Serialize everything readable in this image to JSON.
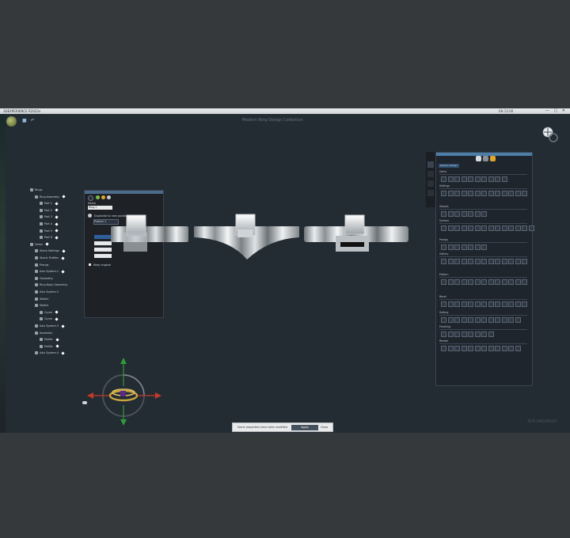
{
  "window": {
    "title": "3DEXPERIENCE R2022x",
    "controls": "— ▢ ✕",
    "tray": "EN 12:00",
    "document_title": "Modern Ring Design Collection"
  },
  "tree": {
    "items": [
      {
        "label": "Rings",
        "indent": 0,
        "pin": false
      },
      {
        "label": "Ring Assembly",
        "indent": 1,
        "pin": true
      },
      {
        "label": "Part 1",
        "indent": 2,
        "pin": true
      },
      {
        "label": "Part 2",
        "indent": 2,
        "pin": true
      },
      {
        "label": "Part 3",
        "indent": 2,
        "pin": true
      },
      {
        "label": "Part 4",
        "indent": 2,
        "pin": true
      },
      {
        "label": "Part 5",
        "indent": 2,
        "pin": true
      },
      {
        "label": "Part 6",
        "indent": 2,
        "pin": true
      },
      {
        "label": "Gems",
        "indent": 0,
        "pin": true
      },
      {
        "label": "Stone Settings",
        "indent": 1,
        "pin": true
      },
      {
        "label": "Shank Profiles",
        "indent": 1,
        "pin": true
      },
      {
        "label": "Prongs",
        "indent": 1,
        "pin": false
      },
      {
        "label": "Axis System.1",
        "indent": 1,
        "pin": true
      },
      {
        "label": "Geometry",
        "indent": 1,
        "pin": false
      },
      {
        "label": "Ring Body Geometry",
        "indent": 1,
        "pin": false
      },
      {
        "label": "Axis System.2",
        "indent": 1,
        "pin": false
      },
      {
        "label": "Sketch",
        "indent": 1,
        "pin": false
      },
      {
        "label": "Sketch",
        "indent": 1,
        "pin": false
      },
      {
        "label": "Curve",
        "indent": 2,
        "pin": true
      },
      {
        "label": "Curve",
        "indent": 2,
        "pin": true
      },
      {
        "label": "Axis System.3",
        "indent": 1,
        "pin": true
      },
      {
        "label": "Assembly",
        "indent": 1,
        "pin": false
      },
      {
        "label": "Profile",
        "indent": 2,
        "pin": true
      },
      {
        "label": "Profile",
        "indent": 2,
        "pin": true
      },
      {
        "label": "Axis System.4",
        "indent": 1,
        "pin": true
      }
    ]
  },
  "left_panel": {
    "field1_label": "Name",
    "field1_value": "Ring.1",
    "option_label": "Duplicate to new position",
    "field2_value": "Position 1",
    "checkbox_label": "Keep original"
  },
  "right_panel": {
    "tab_label": "Jewelry Design",
    "sections": [
      "Gems",
      "Settings",
      "Shanks",
      "Surface",
      "Prongs",
      "Gallery",
      "Pattern",
      "Bezel",
      "Setting",
      "Finishing",
      "Render"
    ]
  },
  "toast": {
    "message": "Some properties have been modified",
    "action_label": "Apply",
    "close_label": "Close"
  },
  "brand": {
    "name": "3DS DASSAULT"
  },
  "colors": {
    "background": "#232b33",
    "panel": "#1f252c",
    "accent": "#4c7fa8",
    "x_axis": "#c23a2a",
    "y_axis": "#2f9a3a",
    "gold": "#c8a640"
  },
  "icons": {
    "app_logo": "compass-logo-icon",
    "navigator": "compass-icon",
    "save": "save-icon",
    "undo": "undo-icon"
  }
}
